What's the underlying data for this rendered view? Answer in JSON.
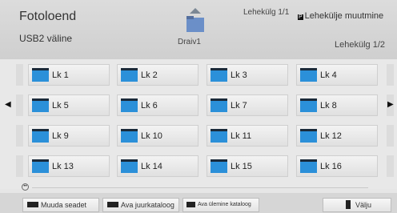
{
  "header": {
    "title": "Fotoloend",
    "source": "USB2 väline",
    "page_indicator_top": "Lehekülg 1/1",
    "page_key_badge": "P",
    "page_change_label": "Lehekülje muutmine",
    "drive_label": "Draiv1",
    "page_indicator_right": "Lehekülg 1/2"
  },
  "grid": {
    "items": [
      "Lk 1",
      "Lk 2",
      "Lk 3",
      "Lk 4",
      "Lk 5",
      "Lk 6",
      "Lk 7",
      "Lk 8",
      "Lk 9",
      "Lk 10",
      "Lk 11",
      "Lk 12",
      "Lk 13",
      "Lk 14",
      "Lk 15",
      "Lk 16"
    ],
    "prev_arrow": "◀",
    "next_arrow": "▶"
  },
  "footer": {
    "buttons": [
      "Muuda seadet",
      "Ava juurkataloog",
      "Ava ülemine kataloog",
      "Välju"
    ]
  },
  "colors": {
    "folder": "#2b90d9",
    "background": "#e6e6e6"
  }
}
